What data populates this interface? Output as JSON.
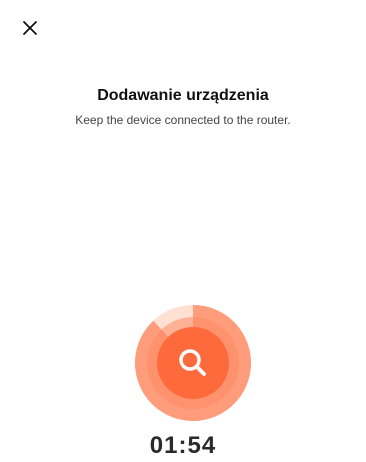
{
  "header": {
    "title": "Dodawanie urządzenia",
    "subtitle": "Keep the device connected to the router."
  },
  "icons": {
    "close": "close-icon",
    "search": "search-icon"
  },
  "scanner": {
    "progress_fraction": 0.88,
    "timer": "01:54"
  },
  "colors": {
    "accent": "#ff6a3d",
    "accent_light": "#ffb39a",
    "accent_pale": "#ffe3d8"
  }
}
